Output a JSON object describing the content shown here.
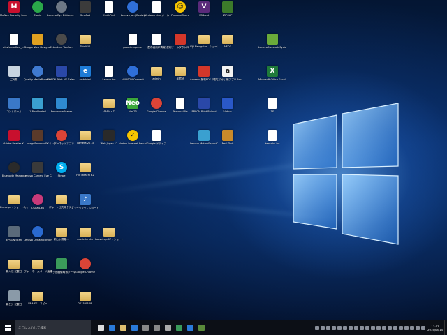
{
  "icons": [
    {
      "label": "McAfee Security Scan Plus",
      "icon": "mcafee-icon",
      "color": "#c8102e",
      "shape": "square",
      "text": "M"
    },
    {
      "label": "Movie",
      "icon": "movie-icon",
      "color": "#2aa84a",
      "shape": "round",
      "text": ""
    },
    {
      "label": "Lenovo Eye Distance System",
      "icon": "eye-icon",
      "color": "#6d7886",
      "shape": "round",
      "text": ""
    },
    {
      "label": "SmaPad",
      "icon": "smapad-icon",
      "color": "#3b3b3b",
      "shape": "square",
      "text": ""
    },
    {
      "label": "MathPad",
      "icon": "document-icon",
      "color": "#ffffff",
      "shape": "doc",
      "text": ""
    },
    {
      "label": "Lenovo Jam(Deutz)",
      "icon": "lenovo-app-icon",
      "color": "#2f6fd8",
      "shape": "round",
      "text": ""
    },
    {
      "label": "Windows Live メール",
      "icon": "document-icon",
      "color": "#ffffff",
      "shape": "doc",
      "text": ""
    },
    {
      "label": "PersonalShare",
      "icon": "smiley-icon",
      "color": "#f5c400",
      "shape": "round",
      "text": "☺"
    },
    {
      "label": "VBBrest",
      "icon": "vbb-icon",
      "color": "#5a2a7a",
      "shape": "square",
      "text": "V"
    },
    {
      "label": "ZIPCAP",
      "icon": "zipcap-icon",
      "color": "#3c7a2a",
      "shape": "square",
      "text": ""
    },
    {
      "label": "clssformatted_j...",
      "icon": "document-icon",
      "color": "#ffffff",
      "shape": "doc",
      "text": ""
    },
    {
      "label": "Google Web Designer",
      "icon": "google-designer-icon",
      "color": "#e0a020",
      "shape": "square",
      "text": ""
    },
    {
      "label": "CyberLink YouCam",
      "icon": "webcam-icon",
      "color": "#4a4a4a",
      "shape": "round",
      "text": ""
    },
    {
      "label": "TotalCiD",
      "icon": "folder-icon",
      "color": "#e0c070",
      "shape": "folder",
      "text": ""
    },
    {
      "label": "pose-image.dxi",
      "icon": "document-icon",
      "color": "#ffffff",
      "shape": "doc",
      "text": ""
    },
    {
      "label": "配布者向け情報",
      "icon": "document-icon",
      "color": "#ffffff",
      "shape": "doc",
      "text": ""
    },
    {
      "label": "便利ツールダウンロード",
      "icon": "red-app-icon",
      "color": "#d4372a",
      "shape": "square",
      "text": ""
    },
    {
      "label": "VIP Navigator - ショートカット",
      "icon": "folder-icon",
      "color": "#e0c070",
      "shape": "folder",
      "text": ""
    },
    {
      "label": "NEOS",
      "icon": "folder-icon",
      "color": "#e0c070",
      "shape": "folder",
      "text": ""
    },
    {
      "label": "Lenovo Network System",
      "icon": "network-icon",
      "color": "#6aaa3a",
      "shape": "square",
      "text": ""
    },
    {
      "label": "ごみ箱",
      "icon": "recycle-bin-icon",
      "color": "#c8d4e0",
      "shape": "square",
      "text": ""
    },
    {
      "label": "Quality MediaBrowser...",
      "icon": "media-icon",
      "color": "#3f7ad0",
      "shape": "round",
      "text": ""
    },
    {
      "label": "EPSON Print ME Select Pages",
      "icon": "epson-icon",
      "color": "#2a48a8",
      "shape": "square",
      "text": ""
    },
    {
      "label": "web.html",
      "icon": "ie-icon",
      "color": "#1e7bd6",
      "shape": "square",
      "text": "e"
    },
    {
      "label": "Launch.txt",
      "icon": "document-icon",
      "color": "#ffffff",
      "shape": "doc",
      "text": ""
    },
    {
      "label": "HUDSON Connect",
      "icon": "globe-icon",
      "color": "#2f6fd8",
      "shape": "round",
      "text": ""
    },
    {
      "label": "admin",
      "icon": "folder-icon",
      "color": "#e0c070",
      "shape": "folder",
      "text": ""
    },
    {
      "label": "年賀状",
      "icon": "folder-icon",
      "color": "#e0c070",
      "shape": "folder",
      "text": ""
    },
    {
      "label": "Amazon 無料PDF アプリ",
      "icon": "pdf-icon",
      "color": "#d4372a",
      "shape": "square",
      "text": ""
    },
    {
      "label": "おこづかい帳アプリ Amazon.co.jp",
      "icon": "amazon-icon",
      "color": "#f2f2f2",
      "shape": "square",
      "text": "a"
    },
    {
      "label": "Microsoft Office Excel Viewer",
      "icon": "excel-icon",
      "color": "#1f7a3a",
      "shape": "square",
      "text": "X"
    },
    {
      "label": "コントロール",
      "icon": "control-panel-icon",
      "color": "#3a78c8",
      "shape": "square",
      "text": ""
    },
    {
      "label": "1-Pixel Install",
      "icon": "install-icon",
      "color": "#3aa0d0",
      "shape": "square",
      "text": ""
    },
    {
      "label": "Panorama Maker",
      "icon": "panorama-icon",
      "color": "#2f8ad0",
      "shape": "square",
      "text": ""
    },
    {
      "label": "プロンプト",
      "icon": "folder-icon",
      "color": "#e0c070",
      "shape": "folder",
      "text": ""
    },
    {
      "label": "Neo23",
      "icon": "neo-icon",
      "color": "#3ba83a",
      "shape": "square",
      "text": "Neo"
    },
    {
      "label": "Google Chrome",
      "icon": "chrome-icon",
      "color": "#db4437",
      "shape": "round",
      "text": ""
    },
    {
      "label": "PersonalFile",
      "icon": "document-icon",
      "color": "#ffffff",
      "shape": "doc",
      "text": ""
    },
    {
      "label": "EPSON Print Reload",
      "icon": "epson-icon",
      "color": "#2a48a8",
      "shape": "square",
      "text": ""
    },
    {
      "label": "Vidiuo",
      "icon": "vidiuo-icon",
      "color": "#2a58c8",
      "shape": "square",
      "text": ""
    },
    {
      "label": "TE",
      "icon": "document-icon",
      "color": "#ffffff",
      "shape": "doc",
      "text": ""
    },
    {
      "label": "Adobe Reader XI",
      "icon": "adobe-reader-icon",
      "color": "#c8102e",
      "shape": "square",
      "text": ""
    },
    {
      "label": "ImageBrowser EX",
      "icon": "image-browser-icon",
      "color": "#5a3a2a",
      "shape": "square",
      "text": ""
    },
    {
      "label": "インターネットアプリ",
      "icon": "chrome-icon",
      "color": "#db4437",
      "shape": "round",
      "text": ""
    },
    {
      "label": "camera 2013",
      "icon": "folder-icon",
      "color": "#e0c070",
      "shape": "folder",
      "text": ""
    },
    {
      "label": "Web Japan 12",
      "icon": "web-japan-icon",
      "color": "#2a2a2a",
      "shape": "square",
      "text": ""
    },
    {
      "label": "Norton Internet Security",
      "icon": "norton-icon",
      "color": "#f5c400",
      "shape": "round",
      "text": "✓"
    },
    {
      "label": "Google ドライブ",
      "icon": "document-icon",
      "color": "#ffffff",
      "shape": "doc",
      "text": ""
    },
    {
      "label": "Lenovo MotionExport 2",
      "icon": "motion-icon",
      "color": "#3aa0d0",
      "shape": "square",
      "text": ""
    },
    {
      "label": "Real Dish",
      "icon": "realdish-icon",
      "color": "#c88a2a",
      "shape": "square",
      "text": ""
    },
    {
      "label": "kensaku.txt",
      "icon": "document-icon",
      "color": "#ffffff",
      "shape": "doc",
      "text": ""
    },
    {
      "label": "Bluetooth Manager",
      "icon": "bluetooth-icon",
      "color": "#2a2a2a",
      "shape": "round",
      "text": ""
    },
    {
      "label": "Lenovo Camera Eye Care",
      "icon": "camera-icon",
      "color": "#3a3a3a",
      "shape": "square",
      "text": ""
    },
    {
      "label": "Skype",
      "icon": "skype-icon",
      "color": "#00aff0",
      "shape": "round",
      "text": "S"
    },
    {
      "label": "File Hitachi 32",
      "icon": "folder-icon",
      "color": "#e0c070",
      "shape": "folder",
      "text": ""
    },
    {
      "label": "Dr.recipe - ショートカット",
      "icon": "folder-icon",
      "color": "#e0c070",
      "shape": "folder",
      "text": ""
    },
    {
      "label": "OKCatLaw",
      "icon": "app-icon",
      "color": "#c83a7a",
      "shape": "round",
      "text": ""
    },
    {
      "label": "ぴゅー - 出力用タスク",
      "icon": "folder-icon",
      "color": "#e0c070",
      "shape": "folder",
      "text": ""
    },
    {
      "label": "ミュージック - ショートカット",
      "icon": "music-icon",
      "color": "#3a78c8",
      "shape": "square",
      "text": "♪"
    },
    {
      "label": "EPSON Scan",
      "icon": "scanner-icon",
      "color": "#5a6a7a",
      "shape": "square",
      "text": ""
    },
    {
      "label": "Lenovo Dynamic Brightness System",
      "icon": "brightness-icon",
      "color": "#2a6ad0",
      "shape": "round",
      "text": ""
    },
    {
      "label": "新しい書類...",
      "icon": "folder-icon",
      "color": "#e0c070",
      "shape": "folder",
      "text": ""
    },
    {
      "label": "music-kinder",
      "icon": "folder-icon",
      "color": "#e0c070",
      "shape": "folder",
      "text": ""
    },
    {
      "label": "kouseirap.07 - ショートカット",
      "icon": "folder-icon",
      "color": "#e0c070",
      "shape": "folder",
      "text": ""
    },
    {
      "label": "新人住 記載日",
      "icon": "folder-icon",
      "color": "#e0c070",
      "shape": "folder",
      "text": ""
    },
    {
      "label": "ぴゅー ホームページ 記載",
      "icon": "folder-icon",
      "color": "#e0c070",
      "shape": "folder",
      "text": ""
    },
    {
      "label": "ページ別画像取得ツール",
      "icon": "image-tool-icon",
      "color": "#3a9a5a",
      "shape": "square",
      "text": ""
    },
    {
      "label": "Google Chrome",
      "icon": "chrome-icon",
      "color": "#db4437",
      "shape": "round",
      "text": ""
    },
    {
      "label": "新任分 記載日",
      "icon": "photo-icon",
      "color": "#8a9aa8",
      "shape": "square",
      "text": ""
    },
    {
      "label": "VBA SE - コピー",
      "icon": "folder-icon",
      "color": "#e0c070",
      "shape": "folder",
      "text": ""
    },
    {
      "label": "2015.06.08",
      "icon": "folder-icon",
      "color": "#e0c070",
      "shape": "folder",
      "text": ""
    }
  ],
  "taskbar": {
    "search_placeholder": "ここに入力して検索",
    "apps": [
      {
        "icon": "task-view-icon",
        "color": "#dddddd"
      },
      {
        "icon": "edge-icon",
        "color": "#2a7ad8"
      },
      {
        "icon": "file-explorer-icon",
        "color": "#e0c070"
      },
      {
        "icon": "store-icon",
        "color": "#2a7ad8"
      },
      {
        "icon": "app-icon",
        "color": "#888888"
      },
      {
        "icon": "app-icon",
        "color": "#888888"
      },
      {
        "icon": "app-icon",
        "color": "#aaaaaa"
      },
      {
        "icon": "photo-icon",
        "color": "#3a9a5a"
      },
      {
        "icon": "app-icon",
        "color": "#2a7ad8"
      },
      {
        "icon": "app-icon",
        "color": "#5a8a3a"
      }
    ],
    "clock_time": "11:57",
    "clock_date": "2015/08/14"
  }
}
